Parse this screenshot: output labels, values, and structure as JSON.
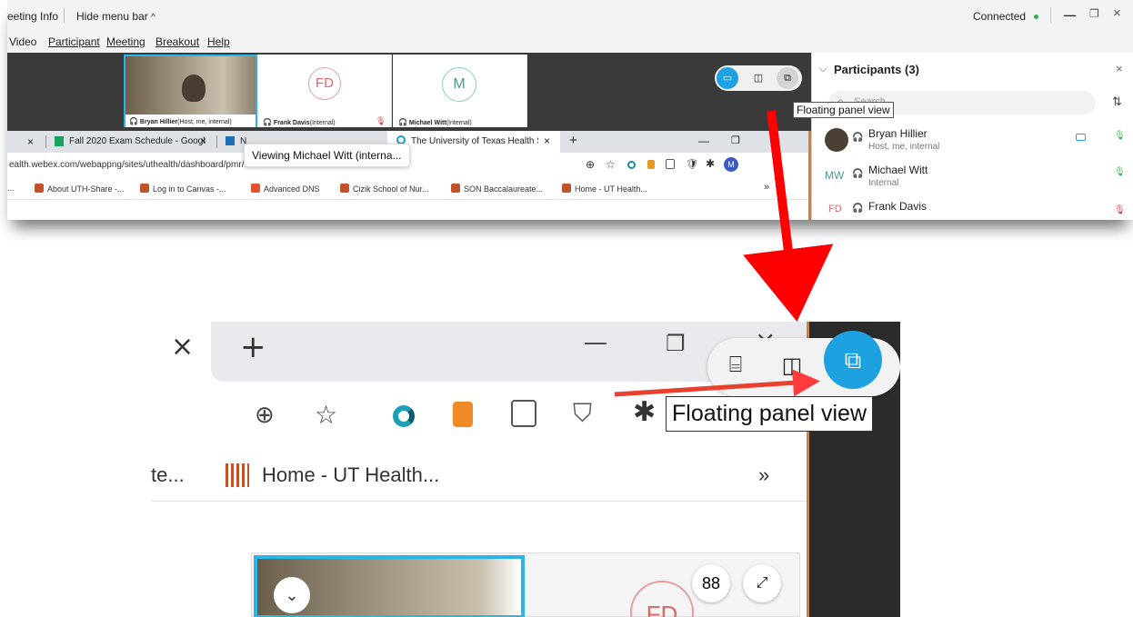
{
  "top": {
    "title_bar": {
      "meeting_info": "eeting Info",
      "hide_menu_bar": "Hide menu bar",
      "hide_chevron": "^",
      "connected": "Connected",
      "minimize": "—",
      "restore": "❐",
      "close": "×"
    },
    "menu": [
      "Video",
      "Participant",
      "Meeting",
      "Breakout",
      "Help"
    ],
    "tiles": [
      {
        "name": "Bryan Hillier",
        "suffix": "(Host, me, internal)"
      },
      {
        "name": "Frank Davis",
        "suffix": "(Internal)",
        "initials": "FD"
      },
      {
        "name": "Michael Witt",
        "suffix": "(Internal)",
        "initials": "M"
      }
    ],
    "chrome": {
      "tabs": [
        {
          "label": "Fall 2020 Exam Schedule - Googl"
        },
        {
          "label": "N"
        },
        {
          "label": "The University of Texas Health Sc"
        }
      ],
      "new_tab": "+",
      "url": "ealth.webex.com/webappng/sites/uthealth/dashboard/pmr/william.b.hillier",
      "tab_close": "×",
      "bookmarks": [
        "About UTH-Share -...",
        "Log in to Canvas -...",
        "Advanced DNS",
        "Cizik School of Nur...",
        "SON Baccalaureate...",
        "Home - UT Health..."
      ],
      "bm_lead": "...",
      "bm_more": "»",
      "profile_initial": "M"
    },
    "viewing_tooltip": "Viewing Michael Witt (interna...",
    "floating_tooltip": "Floating panel view",
    "participants": {
      "header": "Participants (3)",
      "search_placeholder": "Search",
      "list": [
        {
          "name": "Bryan Hillier",
          "sub": "Host, me, internal"
        },
        {
          "name": "Michael Witt",
          "sub": "Internal",
          "initials": "MW"
        },
        {
          "name": "Frank Davis",
          "sub": "",
          "initials": "FD"
        }
      ]
    }
  },
  "zoom": {
    "tab_close": "×",
    "new_tab": "+",
    "minimize": "—",
    "restore": "❐",
    "close": "×",
    "floating_tooltip": "Floating panel view",
    "bookmark_lead": "te...",
    "bookmark_home": "Home - UT Health...",
    "bookmark_more": "»",
    "tile_initials": "FD",
    "grid_icon": "88"
  },
  "colors": {
    "accent_blue": "#1ea1e0",
    "arrow_red": "#ff0000",
    "connected_green": "#2fb24a",
    "tile_border": "#29b6e6"
  }
}
